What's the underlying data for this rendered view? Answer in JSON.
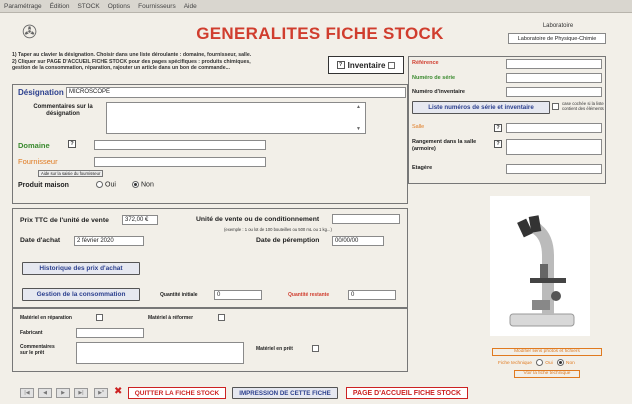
{
  "menu": [
    "Paramétrage",
    "Édition",
    "STOCK",
    "Options",
    "Fournisseurs",
    "Aide"
  ],
  "title": "GENERALITES FICHE STOCK",
  "lab": {
    "label": "Laboratoire",
    "value": "Laboratoire de Physique-Chimie"
  },
  "instructions": {
    "line1": "1) Taper au clavier la désignation. Choisir dans une liste déroulante : domaine, fournisseur, salle.",
    "line2": "2) Cliquer sur PAGE D'ACCUEIL FICHE STOCK pour des pages spécifiques : produits chimiques,",
    "line3": "gestion de la consommation, réparation, rajouter un article dans un bon de commande..."
  },
  "inventaire": {
    "label": "Inventaire"
  },
  "designation": {
    "label": "Désignation",
    "value": "MICROSCOPE",
    "comments_label": "Commentaires sur la désignation"
  },
  "domaine": {
    "label": "Domaine"
  },
  "fournisseur": {
    "label": "Fournisseur",
    "help": "Aide sur la saisie du fournisseur"
  },
  "produit_maison": {
    "label": "Produit maison",
    "oui": "Oui",
    "non": "Non",
    "selected": "Non"
  },
  "right": {
    "reference": "Référence",
    "numero_serie": "Numéro de série",
    "numero_inventaire": "Numéro d'inventaire",
    "liste_button": "Liste numéros de série et inventaire",
    "case_text": "case cochée si la liste contient des éléments",
    "salle": "Salle",
    "rangement": "Rangement dans la salle (armoire)",
    "etagere": "Etagère"
  },
  "prix": {
    "label": "Prix TTC de l'unité de vente",
    "value": "372,00 €",
    "unite_label": "Unité de vente ou de conditionnement",
    "example": "(exemple : 1 ou lot de 100 bouteilles ou 500 mL ou 1 kg...)",
    "date_achat_label": "Date d'achat",
    "date_achat": "2 février 2020",
    "peremption_label": "Date de péremption",
    "peremption": "00/00/00",
    "historique_button": "Historique des prix d'achat"
  },
  "conso": {
    "button": "Gestion de la consommation",
    "qte_init_label": "Quantité initiale",
    "qte_init": "0",
    "qte_rest_label": "Quantité restante",
    "qte_rest": "0"
  },
  "materiel": {
    "reparation": "Matériel en réparation",
    "reformer": "Matériel à réformer",
    "fabricant": "Fabricant",
    "commentaires_pret": "Commentaires sur le prêt",
    "en_pret": "Matériel en prêt"
  },
  "photo": {
    "modifier": "Modifier liens photos et fichiers",
    "fiche_technique": "Fiche technique",
    "oui": "Oui",
    "non": "Non",
    "selected": "Non",
    "voir": "Voir la fiche technique"
  },
  "bottom": {
    "quitter": "QUITTER LA FICHE STOCK",
    "impression": "IMPRESSION DE CETTE FICHE",
    "accueil": "PAGE D'ACCUEIL FICHE STOCK"
  },
  "colors": {
    "accent_red": "#d03d2e",
    "link_blue": "#2b3f8e",
    "label_green": "#3a8a2e",
    "label_orange": "#e07a20"
  }
}
